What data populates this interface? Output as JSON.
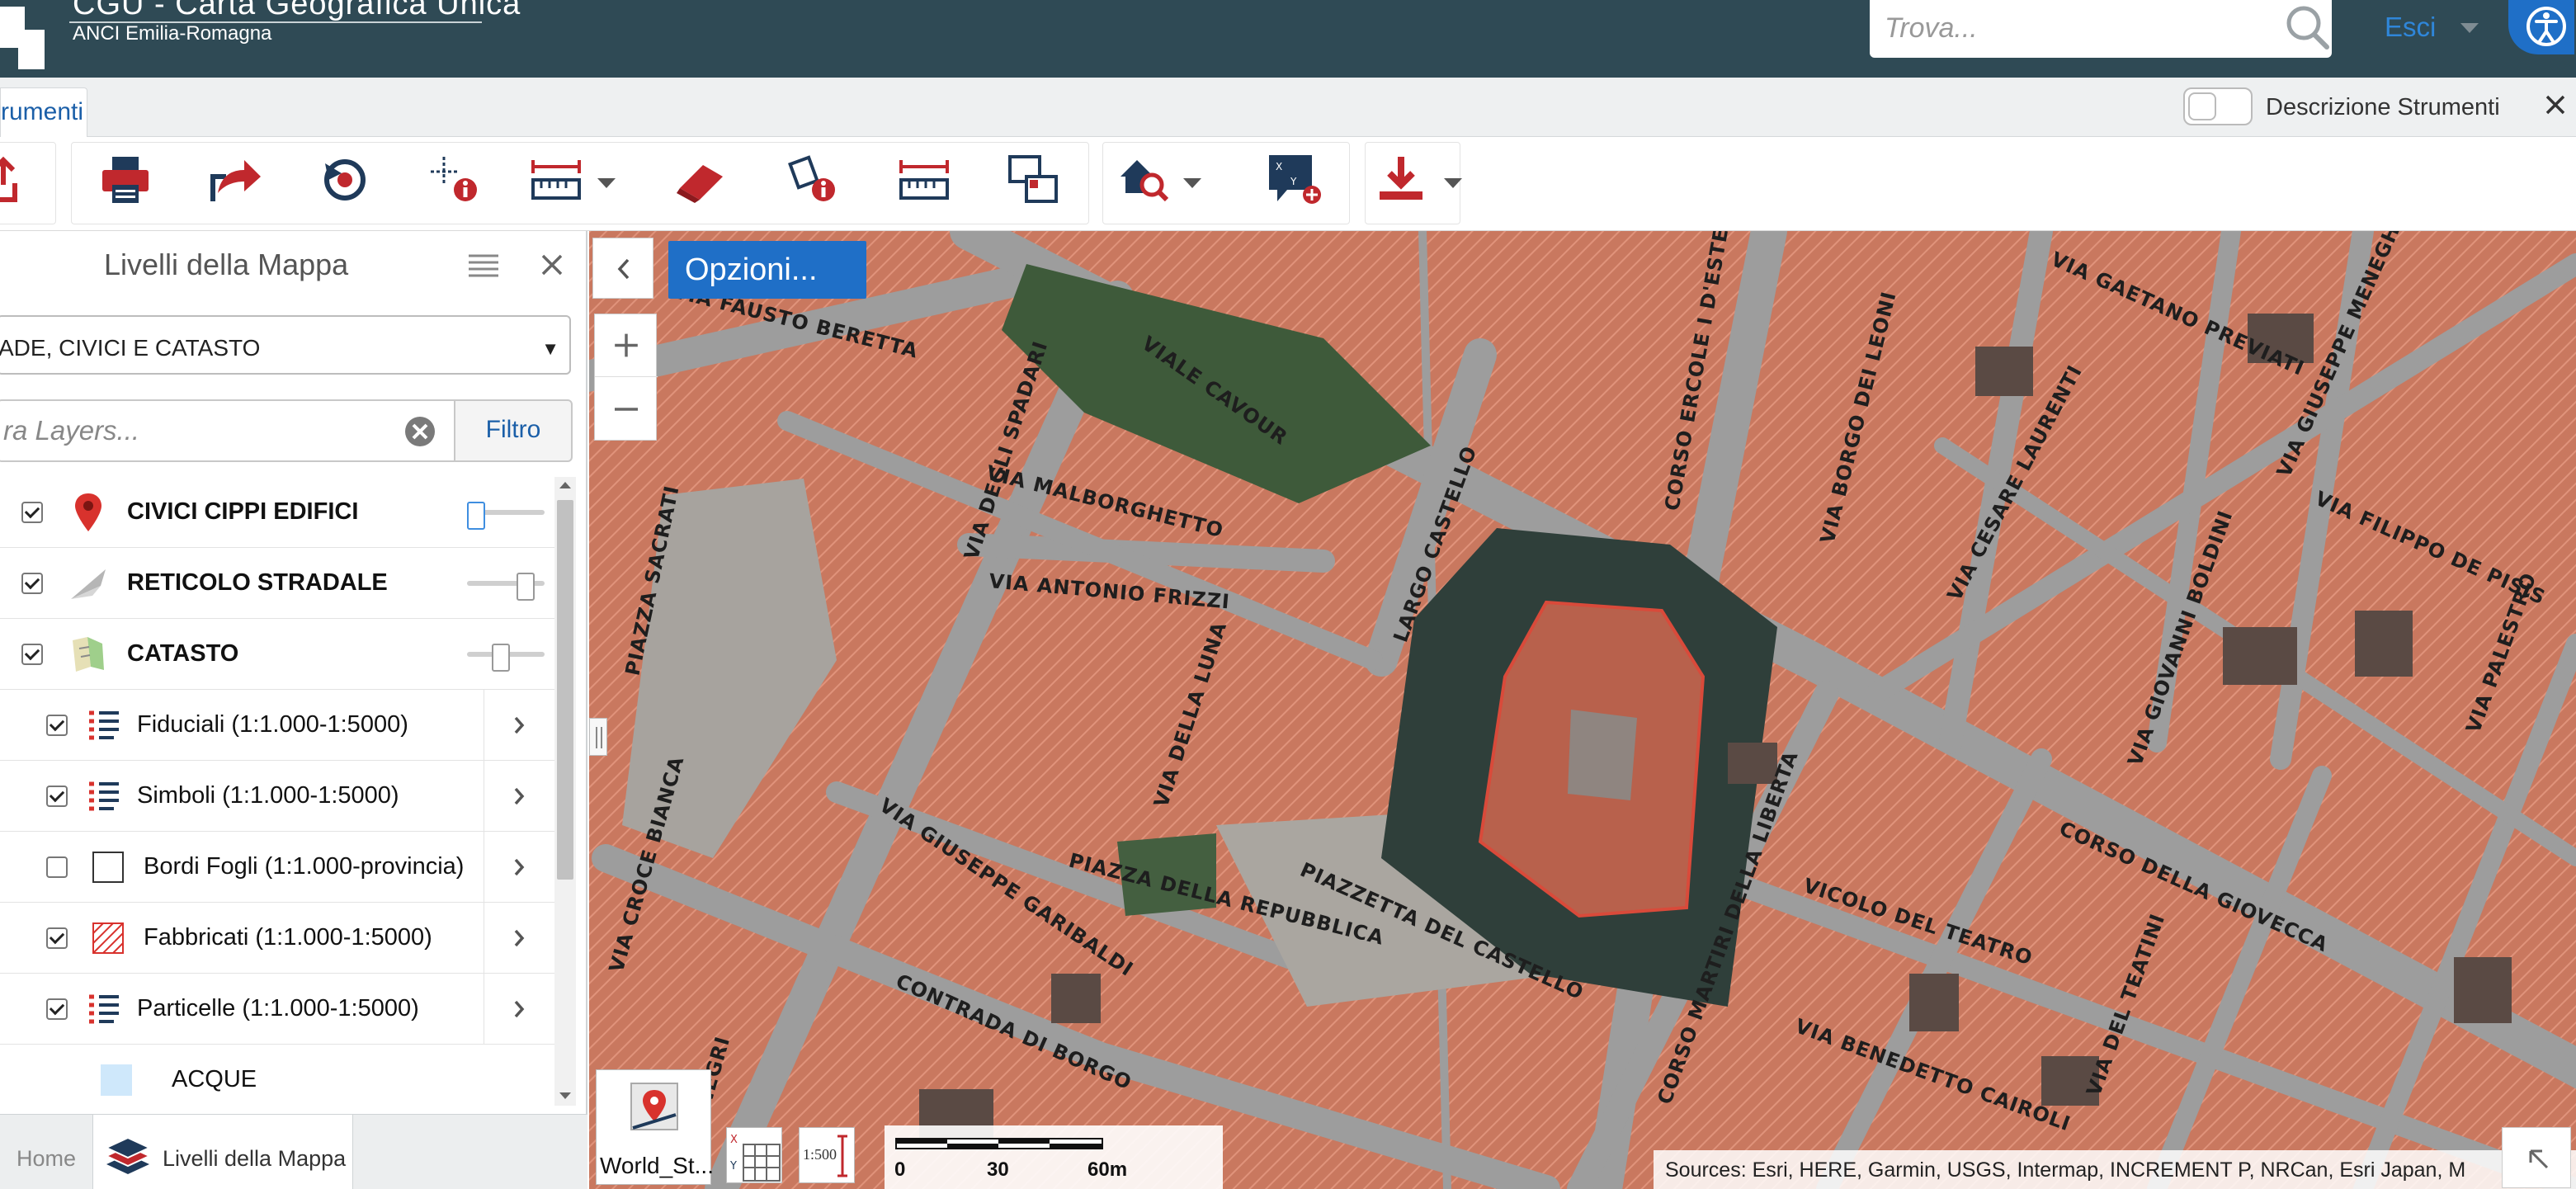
{
  "header": {
    "title": "CGU - Carta Geografica Unica",
    "subtitle": "ANCI Emilia-Romagna",
    "search_placeholder": "Trova...",
    "exit_label": "Esci"
  },
  "tabbar": {
    "active_tab": "rumenti",
    "toggle_label": "Descrizione Strumenti"
  },
  "toolbar": {
    "tools": [
      "upload-icon",
      "print-icon",
      "share-icon",
      "refresh-icon",
      "point-info-icon",
      "measure-icon",
      "eraser-icon",
      "feature-info-icon",
      "distance-icon",
      "compare-icon",
      "home-search-icon",
      "xy-marker-icon",
      "download-icon"
    ]
  },
  "panel": {
    "title": "Livelli della Mappa",
    "selected_group": "ADE, CIVICI E CATASTO",
    "filter_placeholder": "ra Layers...",
    "filter_button": "Filtro",
    "layers": [
      {
        "name": "CIVICI CIPPI EDIFICI",
        "checked": true,
        "bold": true,
        "icon": "pin-icon",
        "opacity": 0.05
      },
      {
        "name": "RETICOLO STRADALE",
        "checked": true,
        "bold": true,
        "icon": "road-icon",
        "opacity": 0.75
      },
      {
        "name": "CATASTO",
        "checked": true,
        "bold": true,
        "icon": "cadastre-icon",
        "opacity": 0.38
      },
      {
        "name": "Fiduciali (1:1.000-1:5000)",
        "checked": true,
        "bold": false,
        "icon": "legend-list-icon",
        "sub": true
      },
      {
        "name": "Simboli (1:1.000-1:5000)",
        "checked": true,
        "bold": false,
        "icon": "legend-list-icon",
        "sub": true
      },
      {
        "name": "Bordi Fogli (1:1.000-provincia)",
        "checked": false,
        "bold": false,
        "icon": "empty-square-icon",
        "sub": true
      },
      {
        "name": "Fabbricati (1:1.000-1:5000)",
        "checked": true,
        "bold": false,
        "icon": "hatched-square-icon",
        "sub": true
      },
      {
        "name": "Particelle (1:1.000-1:5000)",
        "checked": true,
        "bold": false,
        "icon": "legend-list-icon",
        "sub": true
      },
      {
        "name": "ACQUE",
        "legend": true,
        "icon": "water-swatch-icon"
      }
    ],
    "bottom_tabs": {
      "home": "Home",
      "layers": "Livelli della Mappa"
    }
  },
  "map": {
    "options_button": "Opzioni...",
    "basemap_label": "World_St...",
    "scale_button": "1:500",
    "scale_labels": [
      "0",
      "30",
      "60m"
    ],
    "attribution": "Sources: Esri, HERE, Garmin, USGS, Intermap, INCREMENT P, NRCan, Esri Japan, M",
    "streets": [
      "VIA FAUSTO BERETTA",
      "VIA DEGLI SPADARI",
      "VIALE CAVOUR",
      "VIA MALBORGHETTO",
      "VIA ANTONIO FRIZZI",
      "PIAZZA SACRATI",
      "LARGO CASTELLO",
      "CORSO ERCOLE I D'ESTE",
      "VIA BORGO DEI LEONI",
      "VIA GAETANO PREVIATI",
      "VIA CESARE LAURENTI",
      "VIA GIUSEPPE MENEGHINI",
      "VIA FILIPPO DE PISIS",
      "VIA GIOVANNI BOLDINI",
      "VIA DELLA LUNA",
      "VIA GIUSEPPE GARIBALDI",
      "PIAZZA DELLA REPUBBLICA",
      "PIAZZETTA DEL CASTELLO",
      "CORSO MARTIRI DELLA LIBERTA",
      "VICOLO DEL TEATRO",
      "CORSO DELLA GIOVECCA",
      "CONTRADA DI BORGO",
      "VIA BENEDETTO CAIROLI",
      "VIA DEL TEATINI",
      "VIA PALESTRO",
      "VIA CROCE BIANCA",
      "VIA NEGRI"
    ]
  },
  "colors": {
    "header_bg": "#2f4a55",
    "accent": "#1f6fc7",
    "tool_red": "#c0282d",
    "tool_navy": "#1f3a5a"
  }
}
